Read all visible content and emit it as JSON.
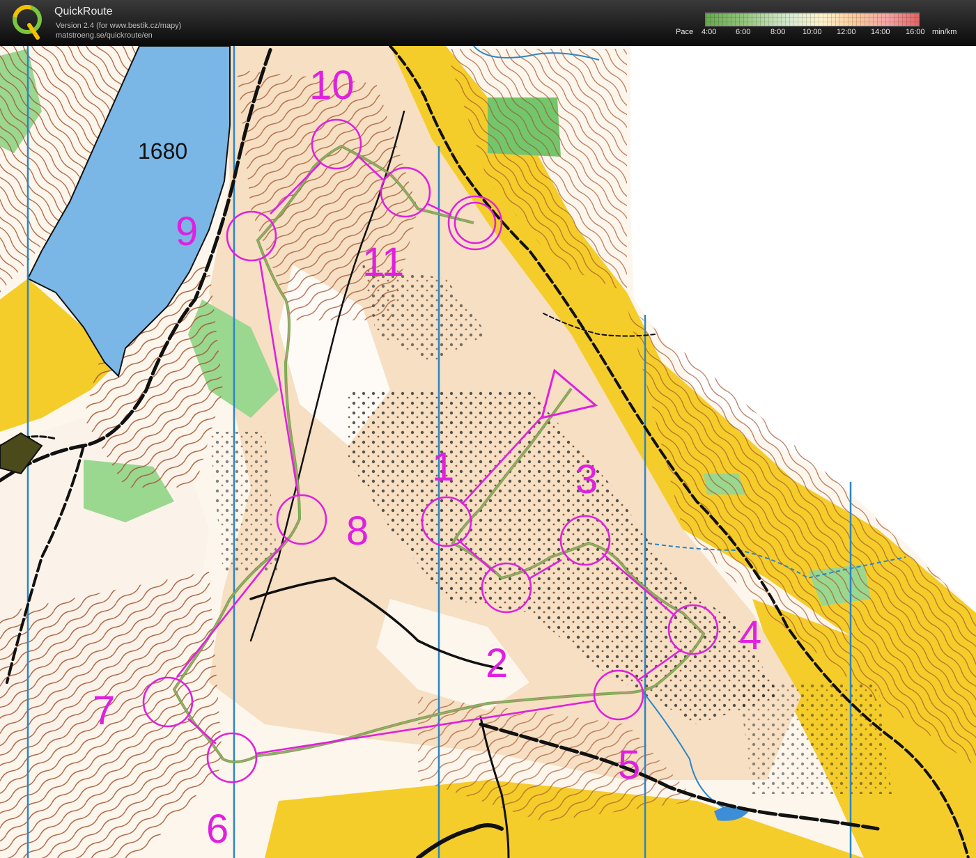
{
  "header": {
    "app_name": "QuickRoute",
    "version_line": "Version 2.4  (for www.bestik.cz/mapy)",
    "url_line": "matstroeng.se/quickroute/en"
  },
  "pace_legend": {
    "label": "Pace",
    "ticks": [
      "4:00",
      "6:00",
      "8:00",
      "10:00",
      "12:00",
      "14:00",
      "16:00"
    ],
    "unit": "min/km",
    "colors": [
      "#6aa84f",
      "#b6d7a8",
      "#fff2cc",
      "#f9cb9c",
      "#e06666"
    ]
  },
  "map": {
    "lake_label": "1680",
    "course_color": "#e020e0",
    "controls": [
      {
        "label": "1"
      },
      {
        "label": "2"
      },
      {
        "label": "3"
      },
      {
        "label": "4"
      },
      {
        "label": "5"
      },
      {
        "label": "6"
      },
      {
        "label": "7"
      },
      {
        "label": "8"
      },
      {
        "label": "9"
      },
      {
        "label": "10"
      },
      {
        "label": "11"
      }
    ]
  }
}
